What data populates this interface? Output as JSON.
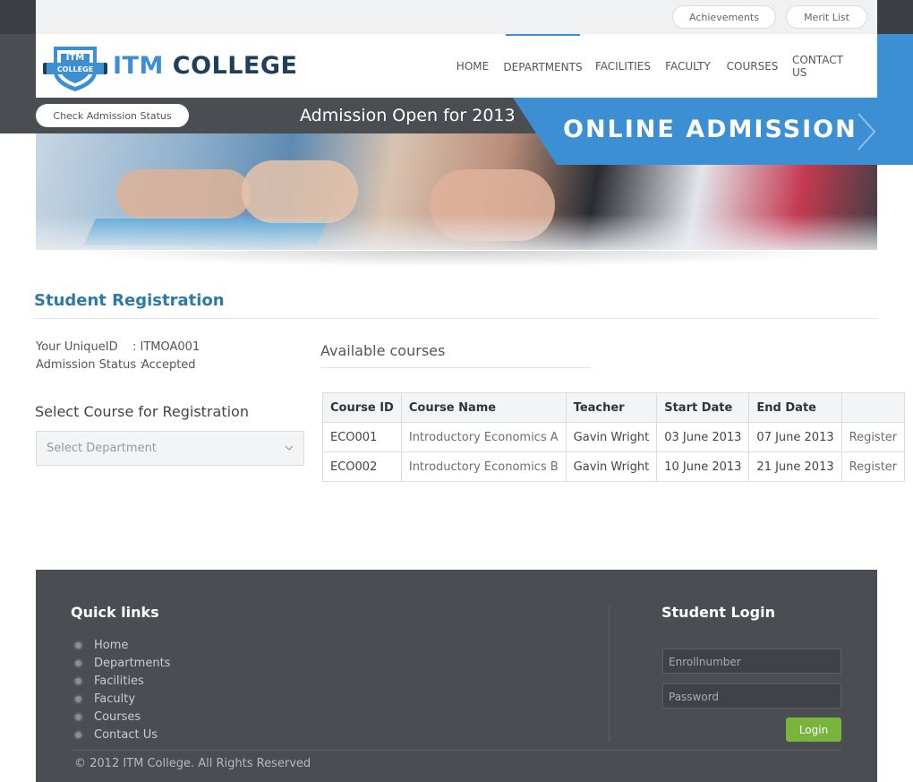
{
  "topbar": {
    "achievements": "Achievements",
    "merit_list": "Merit List"
  },
  "brand": {
    "badge_top": "ITM",
    "badge_bottom": "COLLEGE",
    "name_part1": "ITM",
    "name_part2": "COLLEGE"
  },
  "nav": {
    "items": [
      "HOME",
      "DEPARTMENTS",
      "FACILITIES",
      "FACULTY",
      "COURSES",
      "CONTACT US"
    ],
    "active": "DEPARTMENTS"
  },
  "strip": {
    "check_status": "Check Admission Status",
    "admission_open": "Admission Open for 2013",
    "online_admission": "ONLINE ADMISSION"
  },
  "registration": {
    "title": "Student Registration",
    "unique_id_label": "Your UniqueID",
    "unique_id_value": ": ITMOA001",
    "status_label": "Admission Status :",
    "status_value": "Accepted",
    "select_title": "Select Course for Registration",
    "select_placeholder": "Select Department"
  },
  "courses": {
    "title": "Available courses",
    "columns": [
      "Course ID",
      "Course Name",
      "Teacher",
      "Start Date",
      "End Date",
      ""
    ],
    "rows": [
      [
        "ECO001",
        "Introductory Economics A",
        "Gavin Wright",
        "03 June 2013",
        "07 June 2013",
        "Register"
      ],
      [
        "ECO002",
        "Introductory Economics B",
        "Gavin Wright",
        "10 June 2013",
        "21 June 2013",
        "Register"
      ]
    ]
  },
  "footer": {
    "quick_links_title": "Quick links",
    "links": [
      "Home",
      "Departments",
      "Facilities",
      "Faculty",
      "Courses",
      "Contact Us"
    ],
    "login_title": "Student Login",
    "enroll_placeholder": "Enrollnumber",
    "password_placeholder": "Password",
    "login_button": "Login",
    "copyright": "© 2012 ITM College. All Rights Reserved"
  },
  "colors": {
    "accent_blue": "#3d8fd4",
    "dark": "#4a4d51",
    "login_green": "#7ab33e",
    "title_blue": "#2c7aa8"
  }
}
